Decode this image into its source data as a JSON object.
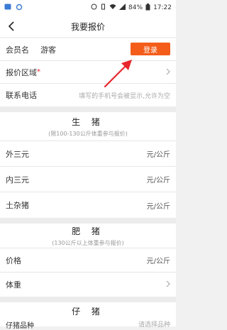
{
  "statusbar": {
    "left_icons": [
      "notification-icon",
      "sync-icon"
    ],
    "battery": "84%",
    "time": "17:22"
  },
  "navbar": {
    "title": "我要报价"
  },
  "member": {
    "label": "会员名",
    "value": "游客",
    "login_button": "登录"
  },
  "region": {
    "label": "报价区域",
    "required_mark": "*"
  },
  "phone": {
    "label": "联系电话",
    "placeholder": "填写的手机号会被显示,允许为空"
  },
  "live_pig": {
    "title": "生 猪",
    "subtitle": "(限100-130公斤体重参与报价)",
    "rows": [
      {
        "label": "外三元",
        "unit": "元/公斤"
      },
      {
        "label": "内三元",
        "unit": "元/公斤"
      },
      {
        "label": "土杂猪",
        "unit": "元/公斤"
      }
    ]
  },
  "fat_pig": {
    "title": "肥 猪",
    "subtitle": "(130公斤以上体重参与报价)",
    "price_label": "价格",
    "price_unit": "元/公斤",
    "weight_label": "体重"
  },
  "piglet": {
    "title": "仔 猪",
    "breed_label": "仔猪品种",
    "breed_placeholder": "请选择品种"
  },
  "colors": {
    "accent": "#f45c1a",
    "annotation_arrow": "#e8262c"
  }
}
